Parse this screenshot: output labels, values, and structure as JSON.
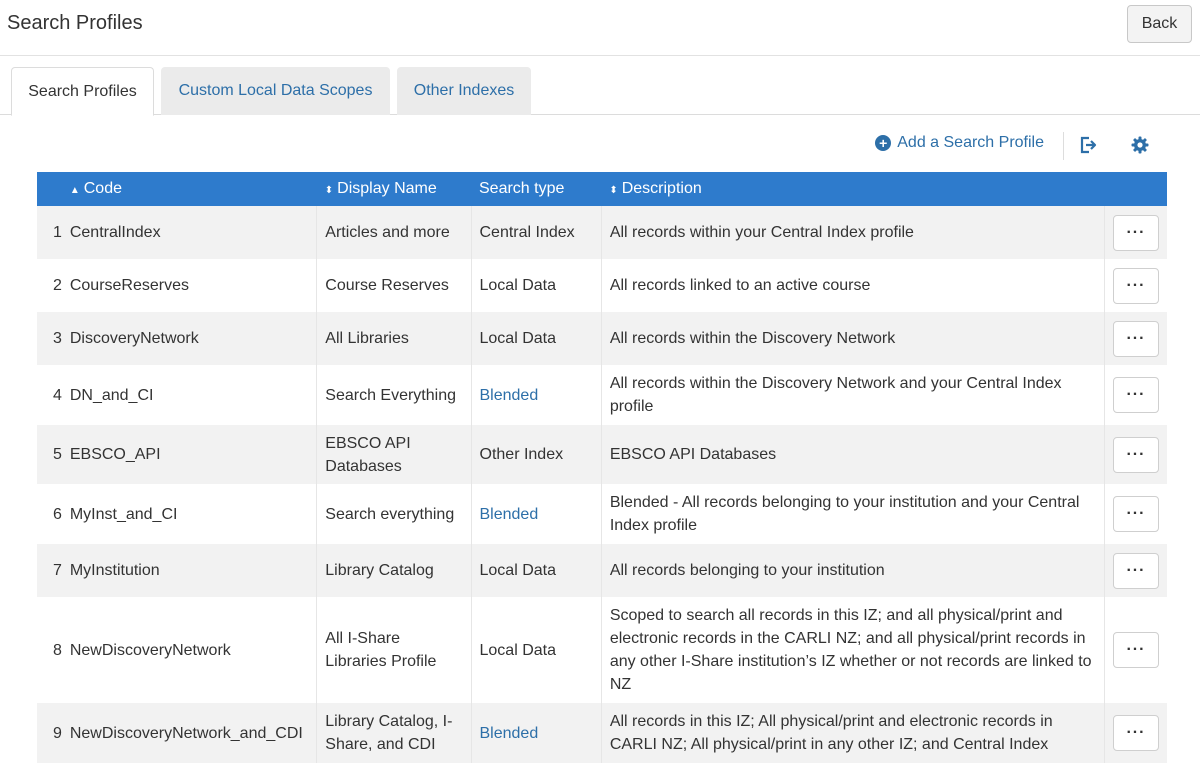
{
  "header": {
    "title": "Search Profiles",
    "back_label": "Back"
  },
  "tabs": [
    {
      "label": "Search Profiles",
      "active": true
    },
    {
      "label": "Custom Local Data Scopes",
      "active": false
    },
    {
      "label": "Other Indexes",
      "active": false
    }
  ],
  "toolbar": {
    "add_label": "Add a Search Profile"
  },
  "table": {
    "columns": {
      "code": "Code",
      "display_name": "Display Name",
      "search_type": "Search type",
      "description": "Description"
    },
    "rows": [
      {
        "num": "1",
        "code": "CentralIndex",
        "name": "Articles and more",
        "type": "Central Index",
        "desc": "All records within your Central Index profile"
      },
      {
        "num": "2",
        "code": "CourseReserves",
        "name": "Course Reserves",
        "type": "Local Data",
        "desc": "All records linked to an active course"
      },
      {
        "num": "3",
        "code": "DiscoveryNetwork",
        "name": "All Libraries",
        "type": "Local Data",
        "desc": "All records within the Discovery Network"
      },
      {
        "num": "4",
        "code": "DN_and_CI",
        "name": "Search Everything",
        "type": "Blended",
        "desc": "All records within the Discovery Network and your Central Index profile"
      },
      {
        "num": "5",
        "code": "EBSCO_API",
        "name": "EBSCO API Databases",
        "type": "Other Index",
        "desc": "EBSCO API Databases"
      },
      {
        "num": "6",
        "code": "MyInst_and_CI",
        "name": "Search everything",
        "type": "Blended",
        "desc": "Blended - All records belonging to your institution and your Central Index profile"
      },
      {
        "num": "7",
        "code": "MyInstitution",
        "name": "Library Catalog",
        "type": "Local Data",
        "desc": "All records belonging to your institution"
      },
      {
        "num": "8",
        "code": "NewDiscoveryNetwork",
        "name": "All I-Share Libraries Profile",
        "type": "Local Data",
        "desc": "Scoped to search all records in this IZ; and all physical/print and electronic records in the CARLI NZ; and all physical/print records in any other I-Share institution’s IZ whether or not records are linked to NZ"
      },
      {
        "num": "9",
        "code": "NewDiscoveryNetwork_and_CDI",
        "name": "Library Catalog, I-Share, and CDI",
        "type": "Blended",
        "desc": "All records in this IZ; All physical/print and electronic records in CARLI NZ; All physical/print in any other IZ; and Central Index"
      }
    ],
    "row_action_label": "···"
  },
  "colors": {
    "header_bg": "#2e7bcc",
    "link": "#2d6fa8",
    "tab_inactive_bg": "#ebebeb"
  }
}
